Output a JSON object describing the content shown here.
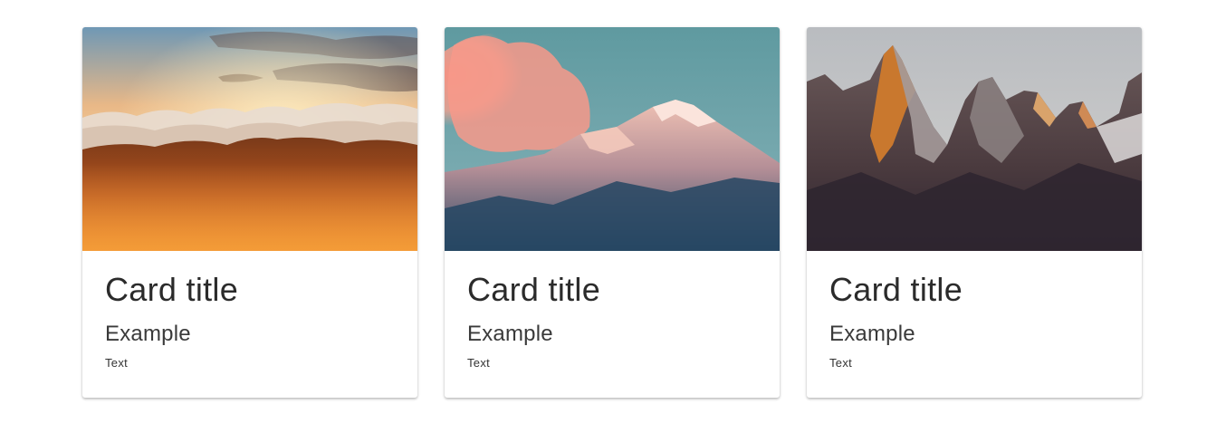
{
  "cards": [
    {
      "image_name": "sunset-clouds-over-mountains",
      "title": "Card title",
      "subtitle": "Example",
      "text": "Text"
    },
    {
      "image_name": "snowy-peak-pink-cloud",
      "title": "Card title",
      "subtitle": "Example",
      "text": "Text"
    },
    {
      "image_name": "rocky-granite-spires",
      "title": "Card title",
      "subtitle": "Example",
      "text": "Text"
    }
  ],
  "colors": {
    "card_background": "#ffffff",
    "title_color": "#2b2b2b",
    "subtitle_color": "#3a3a3a",
    "text_color": "#333333"
  }
}
